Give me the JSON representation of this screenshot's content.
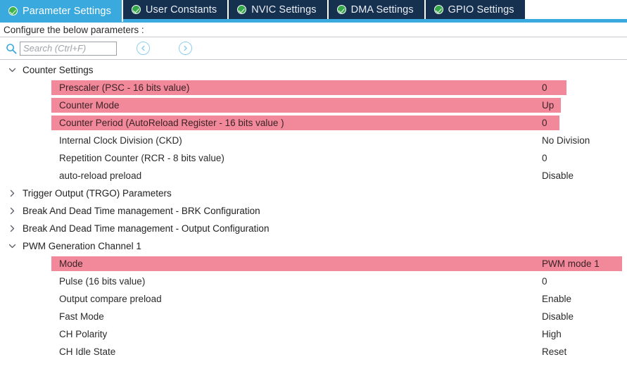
{
  "tabs": [
    {
      "label": "Parameter Settings",
      "icon": "check-circle-icon",
      "active": true
    },
    {
      "label": "User Constants",
      "icon": "check-circle-icon",
      "active": false
    },
    {
      "label": "NVIC Settings",
      "icon": "check-circle-icon",
      "active": false
    },
    {
      "label": "DMA Settings",
      "icon": "check-circle-icon",
      "active": false
    },
    {
      "label": "GPIO Settings",
      "icon": "check-circle-icon",
      "active": false
    }
  ],
  "instruction": "Configure the below parameters :",
  "search": {
    "icon": "search-icon",
    "placeholder": "Search (Ctrl+F)",
    "value": "",
    "prev_icon": "chevron-left-circle-icon",
    "next_icon": "chevron-right-circle-icon"
  },
  "colors": {
    "tab_active": "#3aa9de",
    "tab_inactive": "#16304f",
    "tab_check": "#36a84a",
    "highlight": "#f2899a",
    "nav_button_border": "#8ecdef",
    "separator": "#c8ccd0"
  },
  "groups": [
    {
      "label": "Counter Settings",
      "expanded": true,
      "chevron": "chevron-down-icon",
      "rows": [
        {
          "name": "Prescaler (PSC - 16 bits value)",
          "value": "0",
          "highlight": true,
          "highlight_width": 732
        },
        {
          "name": "Counter Mode",
          "value": "Up",
          "highlight": true,
          "highlight_width": 724
        },
        {
          "name": "Counter Period (AutoReload Register - 16 bits value )",
          "value": "0",
          "highlight": true,
          "highlight_width": 722
        },
        {
          "name": "Internal Clock Division (CKD)",
          "value": "No Division",
          "highlight": false
        },
        {
          "name": "Repetition Counter (RCR - 8 bits value)",
          "value": "0",
          "highlight": false
        },
        {
          "name": "auto-reload preload",
          "value": "Disable",
          "highlight": false
        }
      ]
    },
    {
      "label": "Trigger Output (TRGO) Parameters",
      "expanded": false,
      "chevron": "chevron-right-icon",
      "rows": []
    },
    {
      "label": "Break And Dead Time management - BRK Configuration",
      "expanded": false,
      "chevron": "chevron-right-icon",
      "rows": []
    },
    {
      "label": "Break And Dead Time management - Output Configuration",
      "expanded": false,
      "chevron": "chevron-right-icon",
      "rows": []
    },
    {
      "label": "PWM Generation Channel 1",
      "expanded": true,
      "chevron": "chevron-down-icon",
      "rows": [
        {
          "name": "Mode",
          "value": "PWM mode 1",
          "highlight": true,
          "highlight_width": 811
        },
        {
          "name": "Pulse (16 bits value)",
          "value": "0",
          "highlight": false
        },
        {
          "name": "Output compare preload",
          "value": "Enable",
          "highlight": false
        },
        {
          "name": "Fast Mode",
          "value": "Disable",
          "highlight": false
        },
        {
          "name": "CH Polarity",
          "value": "High",
          "highlight": false
        },
        {
          "name": "CH Idle State",
          "value": "Reset",
          "highlight": false
        }
      ]
    }
  ]
}
